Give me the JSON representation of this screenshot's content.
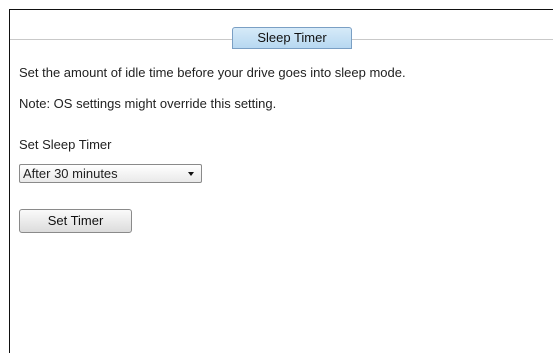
{
  "tab": {
    "label": "Sleep Timer"
  },
  "content": {
    "description": "Set the amount of idle time before your drive goes into sleep mode.",
    "note": "Note: OS settings might override this setting.",
    "field_label": "Set Sleep Timer",
    "select_value": "After 30 minutes",
    "button_label": "Set Timer"
  },
  "icons": {
    "dropdown": "chevron-down-icon"
  }
}
